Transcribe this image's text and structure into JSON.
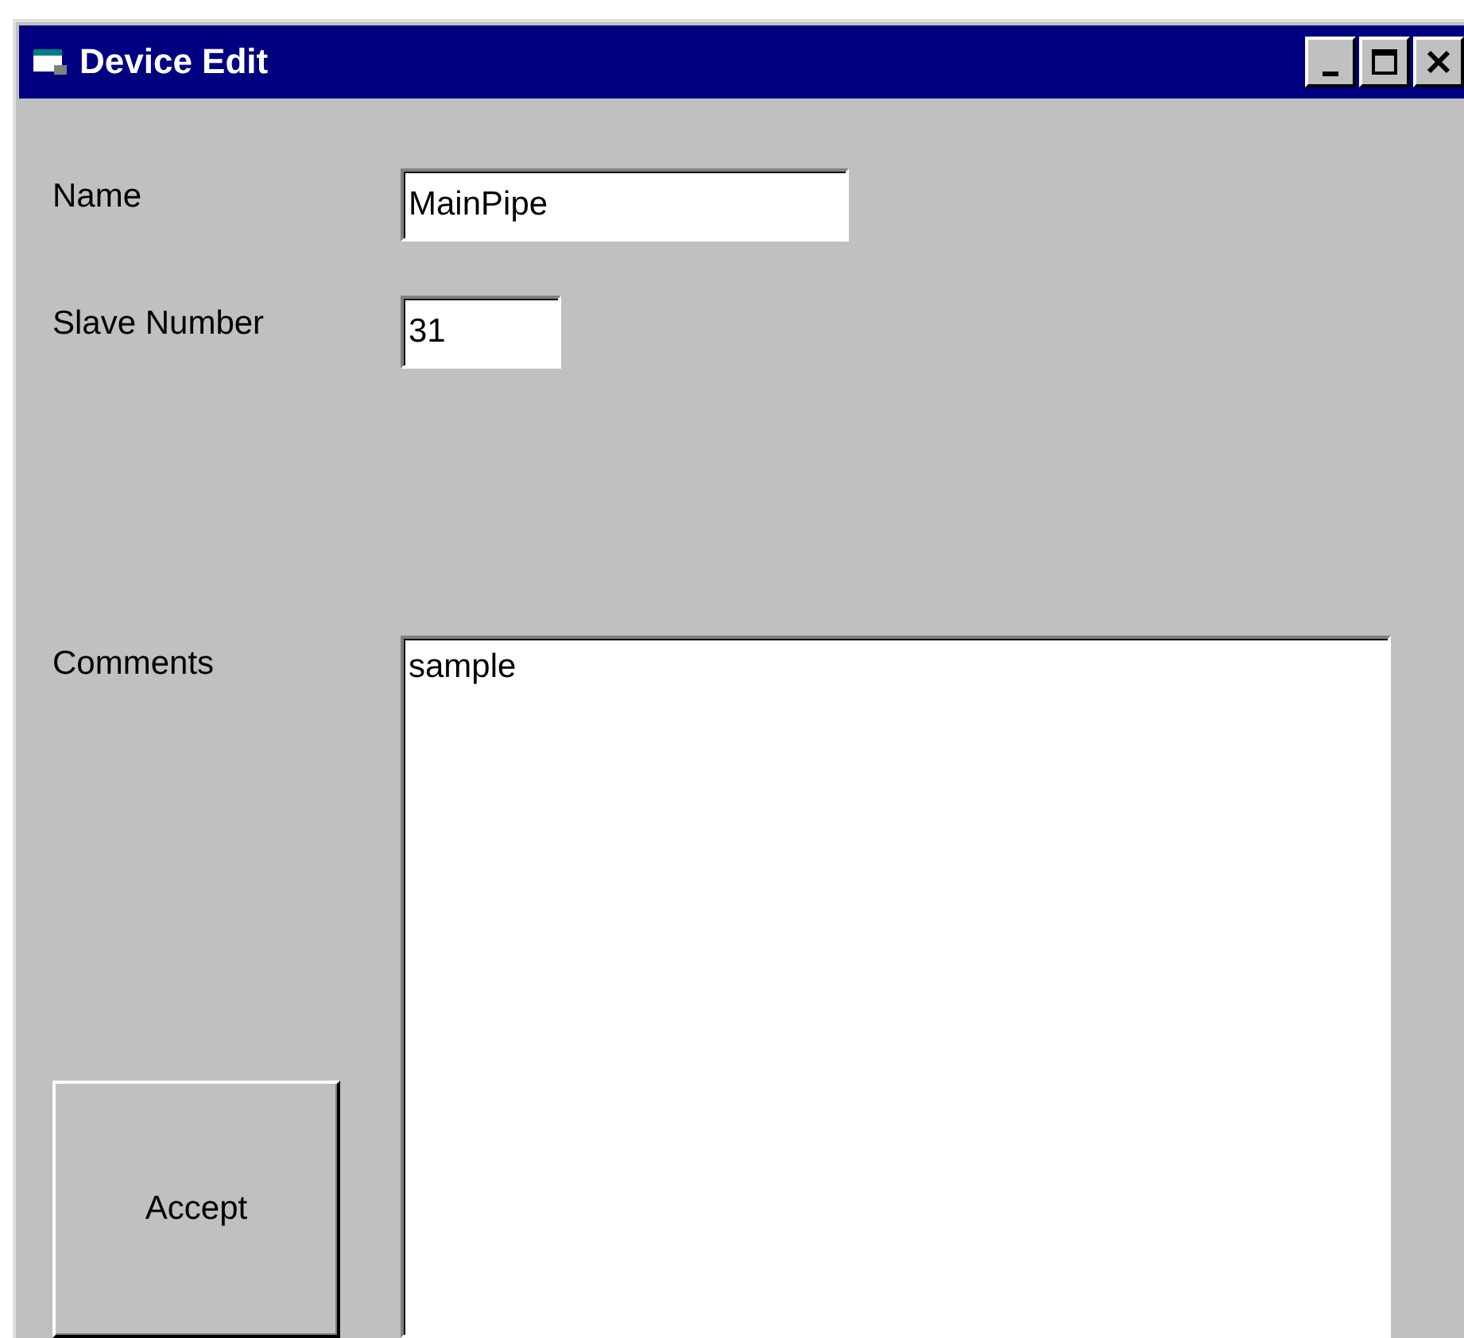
{
  "window": {
    "title": "Device Edit"
  },
  "fields": [
    {
      "label": "Name",
      "value": "MainPipe",
      "kind": "wide"
    },
    {
      "label": "Slave Number",
      "value": "31",
      "kind": "narrow"
    }
  ],
  "comments": {
    "label": "Comments",
    "value": "sample"
  },
  "buttons": [
    "Accept"
  ]
}
